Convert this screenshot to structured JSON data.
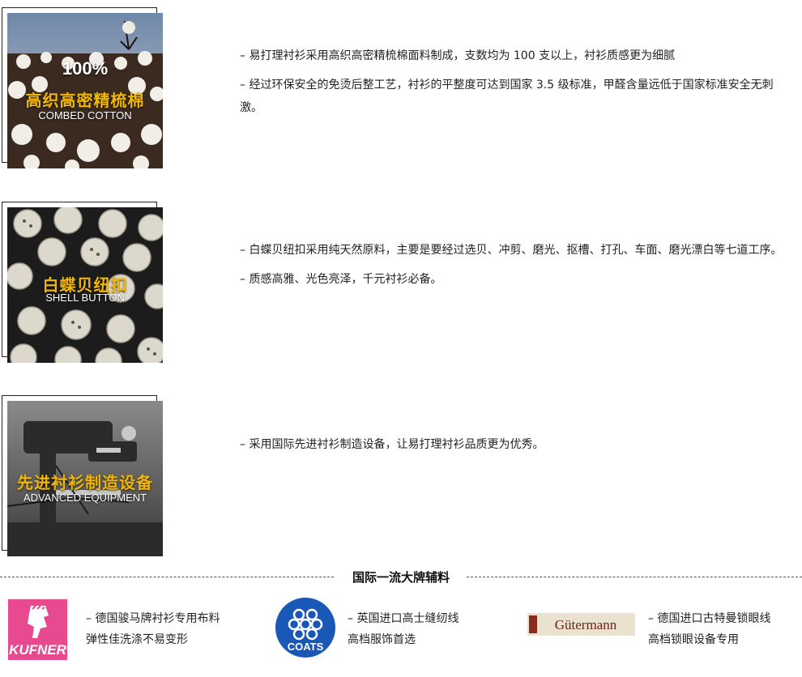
{
  "features": [
    {
      "badge_top": "100%",
      "badge_cn": "高织高密精梳棉",
      "badge_en": "COMBED COTTON",
      "lines": [
        "– 易打理衬衫采用高织高密精梳棉面料制成，支数均为 100 支以上，衬衫质感更为细腻",
        "– 经过环保安全的免烫后整工艺，衬衫的平整度可达到国家 3.5 级标准，甲醛含量远低于国家标准安全无刺激。"
      ]
    },
    {
      "badge_cn": "白蝶贝纽扣",
      "badge_en": "SHELL BUTTON",
      "lines": [
        "– 白蝶贝纽扣采用纯天然原料，主要是要经过选贝、冲剪、磨光、抠槽、打孔、车面、磨光漂白等七道工序。",
        "– 质感高雅、光色亮泽，千元衬衫必备。"
      ]
    },
    {
      "badge_cn": "先进衬衫制造设备",
      "badge_en": "ADVANCED EQUIPMENT",
      "lines": [
        "– 采用国际先进衬衫制造设备，让易打理衬衫品质更为优秀。"
      ]
    }
  ],
  "section_title": "国际一流大牌辅料",
  "brands": [
    {
      "logo_text": "KUFNER",
      "line1": "– 德国骏马牌衬衫专用布料",
      "line2": "弹性佳洗涤不易变形",
      "color": "#e84a8f"
    },
    {
      "logo_text": "COATS",
      "line1": "– 英国进口高士缝纫线",
      "line2": "高档服饰首选",
      "color": "#1a58b8"
    },
    {
      "logo_text": "Gütermann",
      "line1": "– 德国进口古特曼锁眼线",
      "line2": "高档锁眼设备专用",
      "color": "#8c2a1c"
    }
  ]
}
